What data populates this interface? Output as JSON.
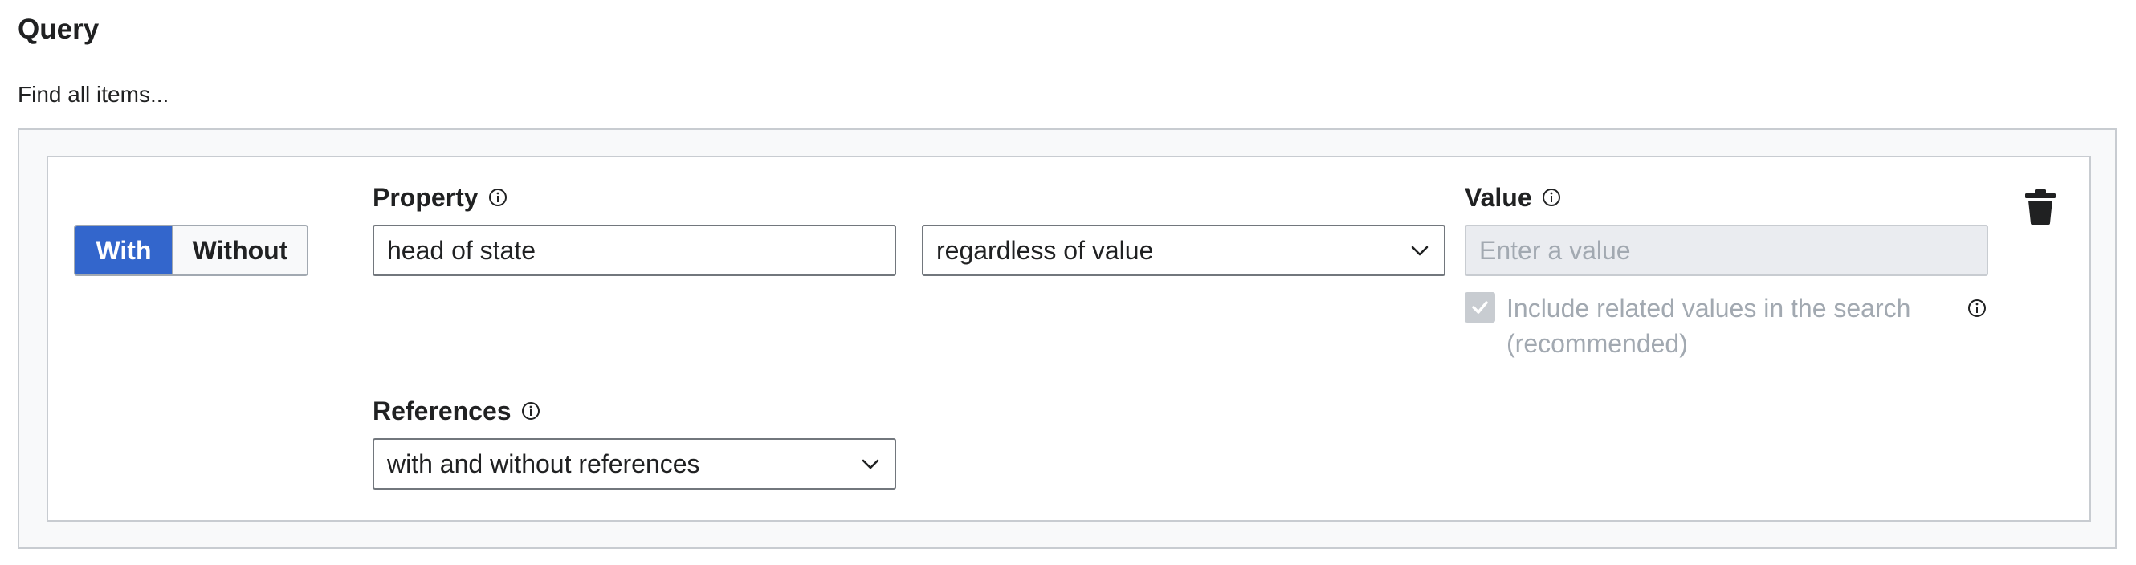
{
  "header": {
    "title": "Query",
    "intro": "Find all items..."
  },
  "condition": {
    "toggle": {
      "with_label": "With",
      "without_label": "Without",
      "selected": "With"
    },
    "property": {
      "label": "Property",
      "value": "head of state"
    },
    "qualifier_select": {
      "selected": "regardless of value"
    },
    "value": {
      "label": "Value",
      "placeholder": "Enter a value",
      "disabled": true
    },
    "include_related": {
      "label": "Include related values in the search (recommended)",
      "checked": true,
      "disabled": true
    },
    "references": {
      "label": "References",
      "selected": "with and without references"
    },
    "icons": {
      "info": "info-icon",
      "chevron": "chevron-down-icon",
      "delete": "trash-icon",
      "check": "check-icon"
    }
  },
  "colors": {
    "accent": "#3366cc",
    "border": "#a2a9b1",
    "disabled_text": "#a2a9b1",
    "panel_bg": "#f8f9fa"
  }
}
